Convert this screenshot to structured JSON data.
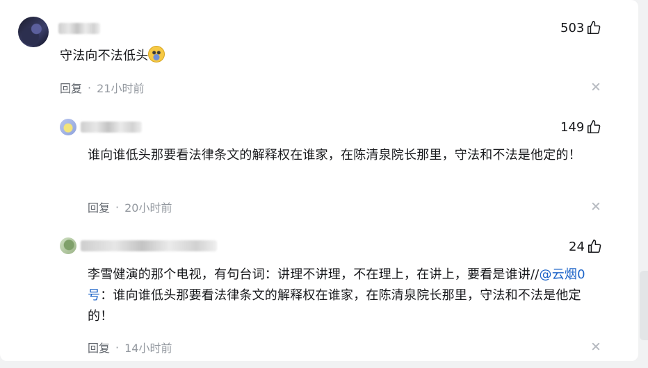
{
  "comments": [
    {
      "likes": "503",
      "text": "守法向不法低头",
      "emoji_icon": "crying-face-emoji-icon",
      "reply_label": "回复",
      "separator": "·",
      "time": "21小时前"
    },
    {
      "likes": "149",
      "text": "谁向谁低头那要看法律条文的解释权在谁家，在陈清泉院长那里，守法和不法是他定的！",
      "reply_label": "回复",
      "separator": "·",
      "time": "20小时前"
    },
    {
      "likes": "24",
      "text_before": "李雪健演的那个电视，有句台词：讲理不讲理，不在理上，在讲上，要看是谁讲//",
      "mention": "@云烟0号",
      "text_after": "：谁向谁低头那要看法律条文的解释权在谁家，在陈清泉院长那里，守法和不法是他定的！",
      "reply_label": "回复",
      "separator": "·",
      "time": "14小时前"
    }
  ],
  "colors": {
    "text": "#18191c",
    "meta": "#9499a0",
    "mention": "#1d64c8",
    "background": "#f1f2f3",
    "card": "#ffffff"
  }
}
